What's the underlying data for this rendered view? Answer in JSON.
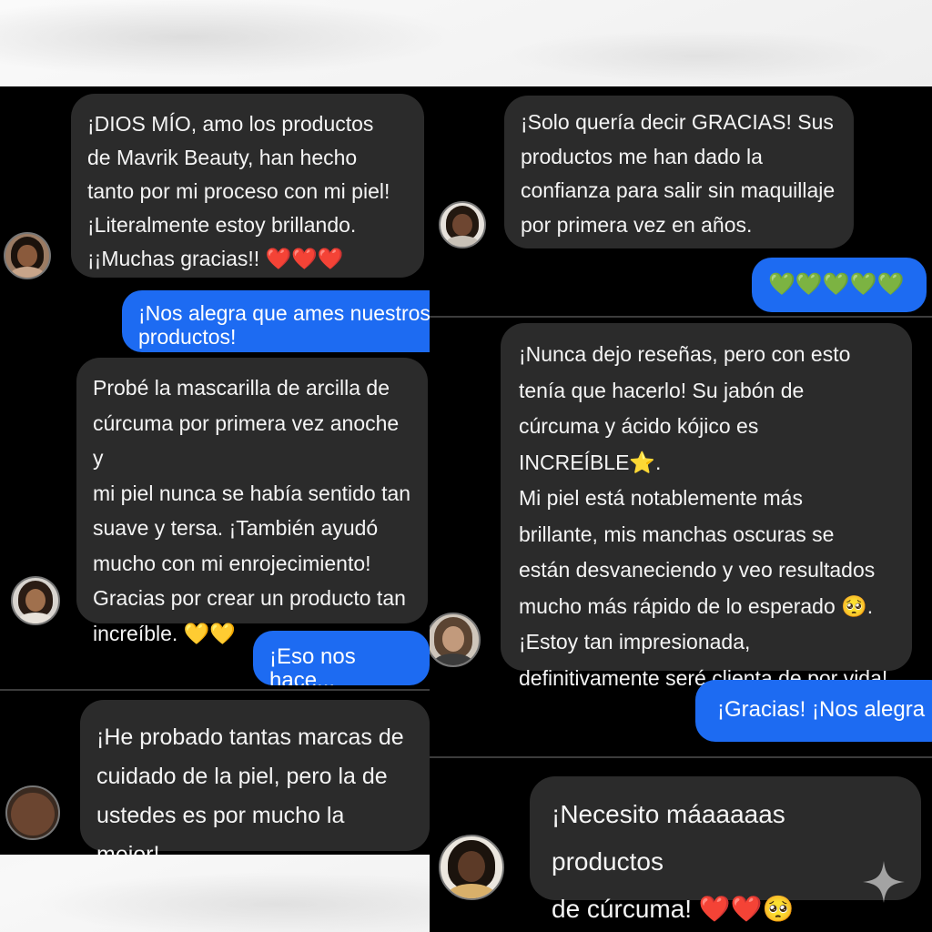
{
  "panels": {
    "p1": {
      "message": "¡DIOS MÍO, amo los productos\nde Mavrik Beauty, han hecho\ntanto por mi proceso con mi piel!\n¡Literalmente estoy brillando.\n¡¡Muchas gracias!! ❤️❤️❤️",
      "reply": "¡Nos alegra que ames nuestros\nproductos!"
    },
    "p2": {
      "message": "Probé la mascarilla de arcilla de\ncúrcuma por primera vez anoche y\nmi piel nunca se había sentido tan\nsuave y tersa. ¡También ayudó\nmucho con mi enrojecimiento!\nGracias por crear un producto tan\nincreíble. 💛💛",
      "reply": "¡Eso nos hace..."
    },
    "p3": {
      "message": "¡He probado tantas marcas de\ncuidado de la piel, pero la de\nustedes es por mucho la mejor!"
    },
    "p4": {
      "message": "¡Solo quería decir GRACIAS! Sus\nproductos me han dado la\nconfianza para salir sin maquillaje\npor primera vez en años.",
      "reply": "💚💚💚💚💚"
    },
    "p5": {
      "message": "¡Nunca dejo reseñas, pero con esto\ntenía que hacerlo! Su jabón de\ncúrcuma y ácido kójico es INCREÍBLE⭐.\nMi piel está notablemente más\nbrillante, mis manchas oscuras se\nestán desvaneciendo y veo resultados\nmucho más rápido de lo esperado 🥺.\n¡Estoy tan impresionada,\ndefinitivamente seré clienta de por vida!",
      "reply": "¡Gracias! ¡Nos alegra"
    },
    "p6": {
      "message": "¡Necesito máaaaaas productos\nde cúrcuma! ❤️❤️🥺"
    }
  },
  "colors": {
    "panel_bg": "#000000",
    "bubble_bg": "#2b2b2b",
    "reply_bg": "#1d6bf2",
    "text": "#f4f4f4"
  },
  "icons": [
    "avatar-icon",
    "sparkle-icon"
  ]
}
